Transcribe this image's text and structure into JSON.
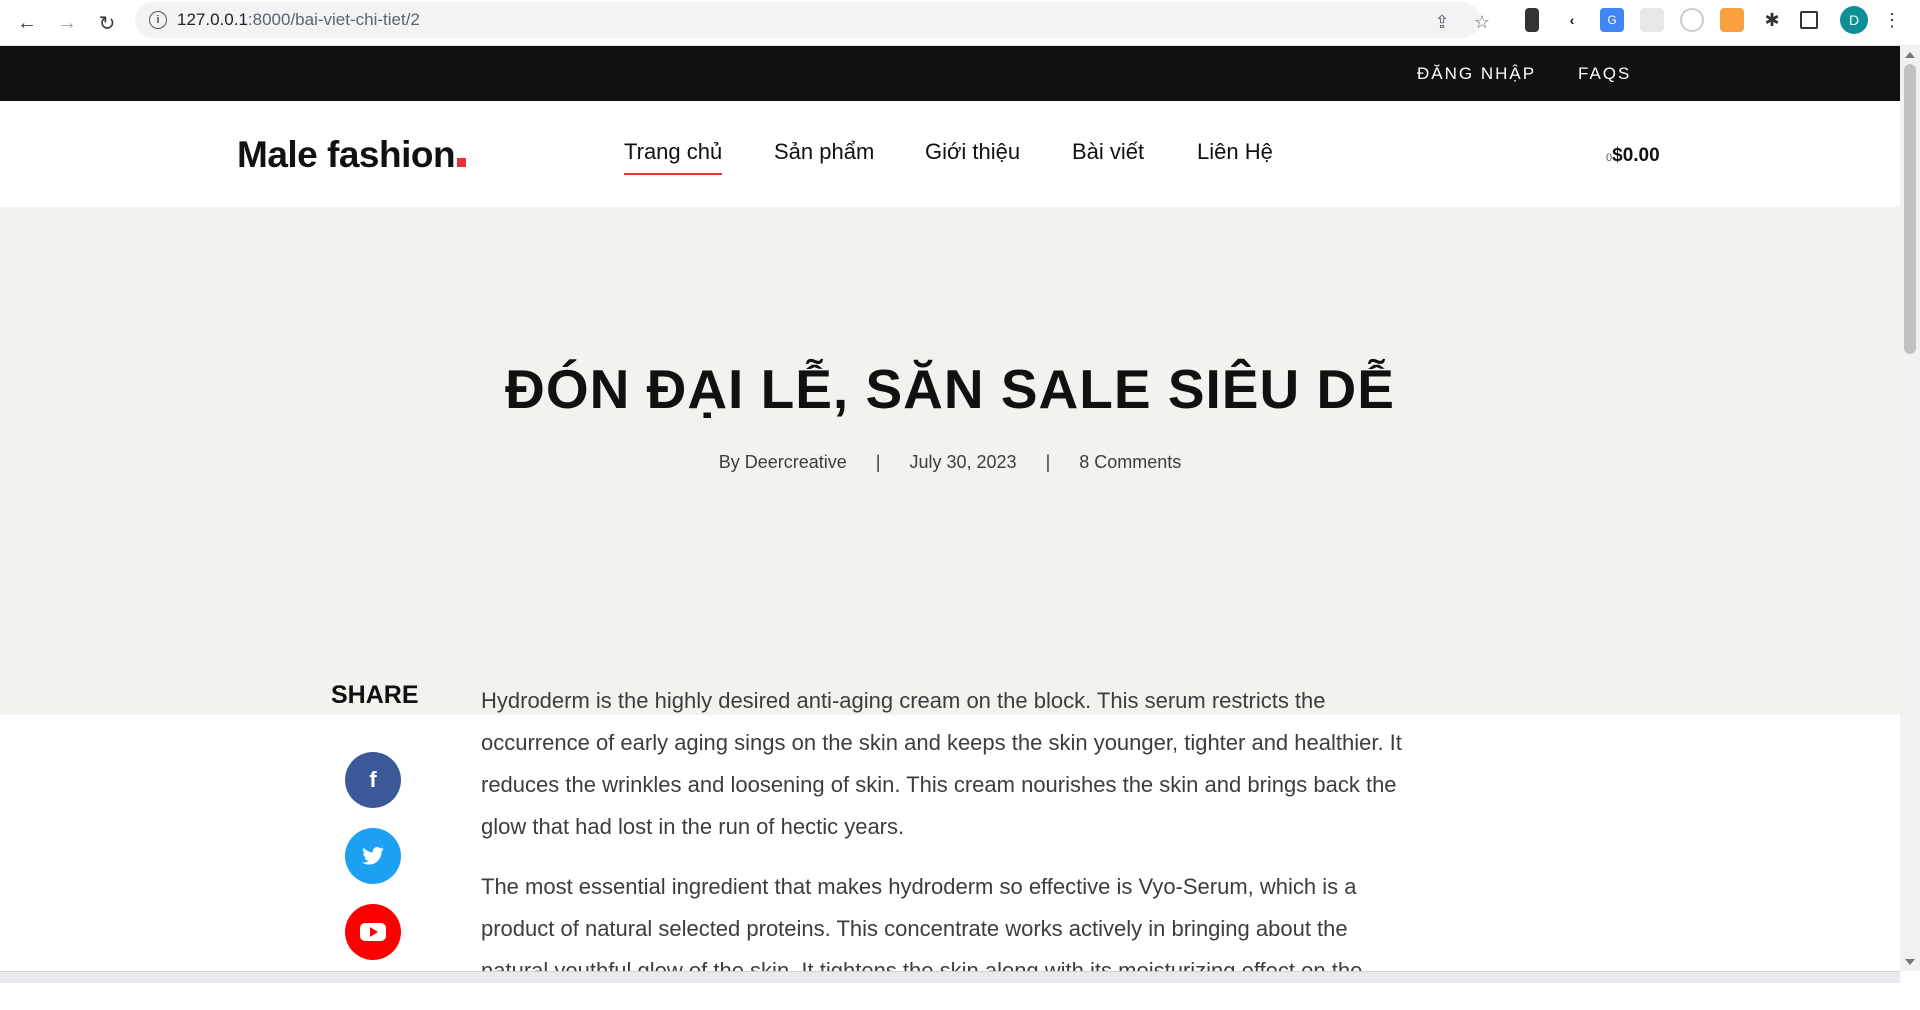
{
  "browser": {
    "url_host": "127.0.0.1",
    "url_path": ":8000/bai-viet-chi-tiet/2",
    "profile_initial": "D"
  },
  "topbar": {
    "login": "ĐĂNG NHẬP",
    "faqs": "FAQS"
  },
  "header": {
    "logo": "Male fashion",
    "menu": [
      "Trang chủ",
      "Sản phẩm",
      "Giới thiệu",
      "Bài viết",
      "Liên Hệ"
    ],
    "cart_count": "0",
    "cart_total": "$0.00"
  },
  "hero": {
    "title": "ĐÓN ĐẠI LỄ, SĂN SALE SIÊU DỄ",
    "author": "By Deercreative",
    "date": "July 30, 2023",
    "comments": "8 Comments",
    "separator": "|"
  },
  "share": {
    "title": "SHARE",
    "networks": [
      "facebook-icon",
      "twitter-icon",
      "youtube-icon"
    ]
  },
  "article": {
    "paragraphs": [
      "Hydroderm is the highly desired anti-aging cream on the block. This serum restricts the occurrence of early aging sings on the skin and keeps the skin younger, tighter and healthier. It reduces the wrinkles and loosening of skin. This cream nourishes the skin and brings back the glow that had lost in the run of hectic years.",
      "The most essential ingredient that makes hydroderm so effective is Vyo-Serum, which is a product of natural selected proteins. This concentrate works actively in bringing about the natural youthful glow of the skin. It tightens the skin along with its moisturizing effect on the"
    ]
  },
  "colors": {
    "accent": "#e53637",
    "topbar_bg": "#111111",
    "hero_bg": "#f3f2ee",
    "facebook": "#3b5998",
    "twitter": "#1da1f2",
    "youtube": "#ff0000"
  }
}
